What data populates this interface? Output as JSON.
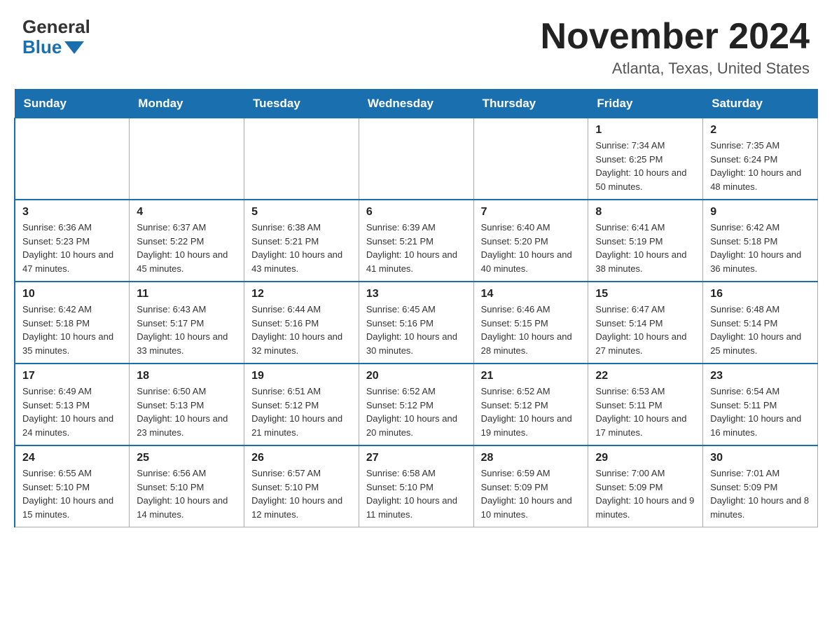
{
  "header": {
    "logo_general": "General",
    "logo_blue": "Blue",
    "month_title": "November 2024",
    "location": "Atlanta, Texas, United States"
  },
  "weekdays": [
    "Sunday",
    "Monday",
    "Tuesday",
    "Wednesday",
    "Thursday",
    "Friday",
    "Saturday"
  ],
  "weeks": [
    [
      {
        "day": "",
        "sunrise": "",
        "sunset": "",
        "daylight": ""
      },
      {
        "day": "",
        "sunrise": "",
        "sunset": "",
        "daylight": ""
      },
      {
        "day": "",
        "sunrise": "",
        "sunset": "",
        "daylight": ""
      },
      {
        "day": "",
        "sunrise": "",
        "sunset": "",
        "daylight": ""
      },
      {
        "day": "",
        "sunrise": "",
        "sunset": "",
        "daylight": ""
      },
      {
        "day": "1",
        "sunrise": "Sunrise: 7:34 AM",
        "sunset": "Sunset: 6:25 PM",
        "daylight": "Daylight: 10 hours and 50 minutes."
      },
      {
        "day": "2",
        "sunrise": "Sunrise: 7:35 AM",
        "sunset": "Sunset: 6:24 PM",
        "daylight": "Daylight: 10 hours and 48 minutes."
      }
    ],
    [
      {
        "day": "3",
        "sunrise": "Sunrise: 6:36 AM",
        "sunset": "Sunset: 5:23 PM",
        "daylight": "Daylight: 10 hours and 47 minutes."
      },
      {
        "day": "4",
        "sunrise": "Sunrise: 6:37 AM",
        "sunset": "Sunset: 5:22 PM",
        "daylight": "Daylight: 10 hours and 45 minutes."
      },
      {
        "day": "5",
        "sunrise": "Sunrise: 6:38 AM",
        "sunset": "Sunset: 5:21 PM",
        "daylight": "Daylight: 10 hours and 43 minutes."
      },
      {
        "day": "6",
        "sunrise": "Sunrise: 6:39 AM",
        "sunset": "Sunset: 5:21 PM",
        "daylight": "Daylight: 10 hours and 41 minutes."
      },
      {
        "day": "7",
        "sunrise": "Sunrise: 6:40 AM",
        "sunset": "Sunset: 5:20 PM",
        "daylight": "Daylight: 10 hours and 40 minutes."
      },
      {
        "day": "8",
        "sunrise": "Sunrise: 6:41 AM",
        "sunset": "Sunset: 5:19 PM",
        "daylight": "Daylight: 10 hours and 38 minutes."
      },
      {
        "day": "9",
        "sunrise": "Sunrise: 6:42 AM",
        "sunset": "Sunset: 5:18 PM",
        "daylight": "Daylight: 10 hours and 36 minutes."
      }
    ],
    [
      {
        "day": "10",
        "sunrise": "Sunrise: 6:42 AM",
        "sunset": "Sunset: 5:18 PM",
        "daylight": "Daylight: 10 hours and 35 minutes."
      },
      {
        "day": "11",
        "sunrise": "Sunrise: 6:43 AM",
        "sunset": "Sunset: 5:17 PM",
        "daylight": "Daylight: 10 hours and 33 minutes."
      },
      {
        "day": "12",
        "sunrise": "Sunrise: 6:44 AM",
        "sunset": "Sunset: 5:16 PM",
        "daylight": "Daylight: 10 hours and 32 minutes."
      },
      {
        "day": "13",
        "sunrise": "Sunrise: 6:45 AM",
        "sunset": "Sunset: 5:16 PM",
        "daylight": "Daylight: 10 hours and 30 minutes."
      },
      {
        "day": "14",
        "sunrise": "Sunrise: 6:46 AM",
        "sunset": "Sunset: 5:15 PM",
        "daylight": "Daylight: 10 hours and 28 minutes."
      },
      {
        "day": "15",
        "sunrise": "Sunrise: 6:47 AM",
        "sunset": "Sunset: 5:14 PM",
        "daylight": "Daylight: 10 hours and 27 minutes."
      },
      {
        "day": "16",
        "sunrise": "Sunrise: 6:48 AM",
        "sunset": "Sunset: 5:14 PM",
        "daylight": "Daylight: 10 hours and 25 minutes."
      }
    ],
    [
      {
        "day": "17",
        "sunrise": "Sunrise: 6:49 AM",
        "sunset": "Sunset: 5:13 PM",
        "daylight": "Daylight: 10 hours and 24 minutes."
      },
      {
        "day": "18",
        "sunrise": "Sunrise: 6:50 AM",
        "sunset": "Sunset: 5:13 PM",
        "daylight": "Daylight: 10 hours and 23 minutes."
      },
      {
        "day": "19",
        "sunrise": "Sunrise: 6:51 AM",
        "sunset": "Sunset: 5:12 PM",
        "daylight": "Daylight: 10 hours and 21 minutes."
      },
      {
        "day": "20",
        "sunrise": "Sunrise: 6:52 AM",
        "sunset": "Sunset: 5:12 PM",
        "daylight": "Daylight: 10 hours and 20 minutes."
      },
      {
        "day": "21",
        "sunrise": "Sunrise: 6:52 AM",
        "sunset": "Sunset: 5:12 PM",
        "daylight": "Daylight: 10 hours and 19 minutes."
      },
      {
        "day": "22",
        "sunrise": "Sunrise: 6:53 AM",
        "sunset": "Sunset: 5:11 PM",
        "daylight": "Daylight: 10 hours and 17 minutes."
      },
      {
        "day": "23",
        "sunrise": "Sunrise: 6:54 AM",
        "sunset": "Sunset: 5:11 PM",
        "daylight": "Daylight: 10 hours and 16 minutes."
      }
    ],
    [
      {
        "day": "24",
        "sunrise": "Sunrise: 6:55 AM",
        "sunset": "Sunset: 5:10 PM",
        "daylight": "Daylight: 10 hours and 15 minutes."
      },
      {
        "day": "25",
        "sunrise": "Sunrise: 6:56 AM",
        "sunset": "Sunset: 5:10 PM",
        "daylight": "Daylight: 10 hours and 14 minutes."
      },
      {
        "day": "26",
        "sunrise": "Sunrise: 6:57 AM",
        "sunset": "Sunset: 5:10 PM",
        "daylight": "Daylight: 10 hours and 12 minutes."
      },
      {
        "day": "27",
        "sunrise": "Sunrise: 6:58 AM",
        "sunset": "Sunset: 5:10 PM",
        "daylight": "Daylight: 10 hours and 11 minutes."
      },
      {
        "day": "28",
        "sunrise": "Sunrise: 6:59 AM",
        "sunset": "Sunset: 5:09 PM",
        "daylight": "Daylight: 10 hours and 10 minutes."
      },
      {
        "day": "29",
        "sunrise": "Sunrise: 7:00 AM",
        "sunset": "Sunset: 5:09 PM",
        "daylight": "Daylight: 10 hours and 9 minutes."
      },
      {
        "day": "30",
        "sunrise": "Sunrise: 7:01 AM",
        "sunset": "Sunset: 5:09 PM",
        "daylight": "Daylight: 10 hours and 8 minutes."
      }
    ]
  ]
}
